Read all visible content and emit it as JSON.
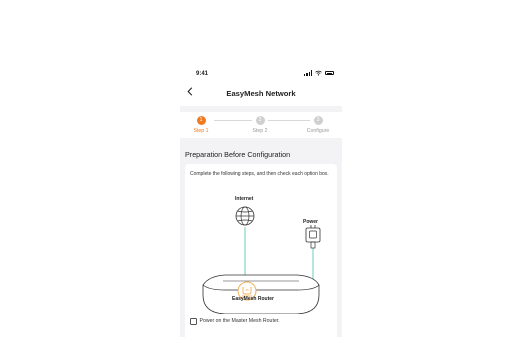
{
  "status_bar": {
    "time": "9:41",
    "icons": [
      "signal-icon",
      "wifi-icon",
      "battery-icon"
    ]
  },
  "nav": {
    "back_icon": "chevron-left-icon",
    "title": "EasyMesh Network"
  },
  "stepper": {
    "steps": [
      {
        "number": "1",
        "label": "Step 1",
        "state": "active"
      },
      {
        "number": "2",
        "label": "Step 2",
        "state": "inactive"
      },
      {
        "number": "3",
        "label": "Configure",
        "state": "inactive"
      }
    ],
    "accent": "#f07a22",
    "inactive_color": "#cfcfcf"
  },
  "section": {
    "title": "Preparation Before Configuration"
  },
  "card": {
    "intro": "Complete the following steps, and then check each option box.",
    "diagram": {
      "internet_label": "Internet",
      "power_label": "Power",
      "router_label": "EasyMesh Router",
      "cable_color": "#7fd0c2"
    },
    "checkbox": {
      "label": "Power on the Master Mesh Router.",
      "checked": false
    }
  }
}
